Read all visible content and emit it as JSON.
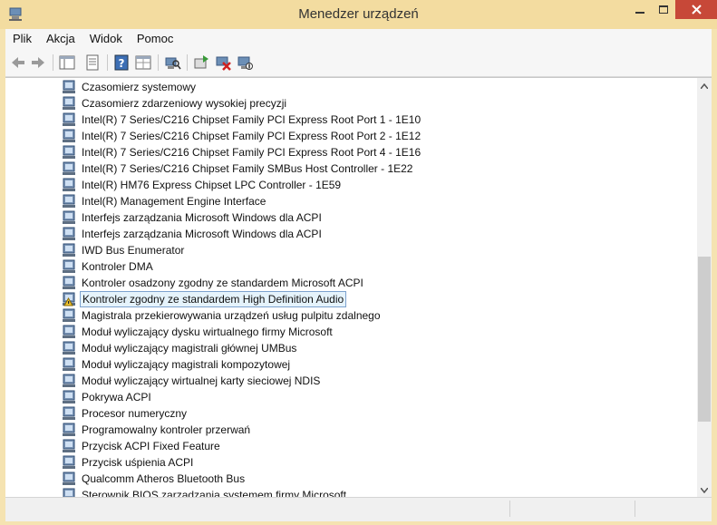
{
  "window": {
    "title": "Menedzer urządzeń",
    "colors": {
      "frame": "#f5e3b1",
      "close": "#c74838",
      "selection_border": "#7da2ce",
      "selection_fill": "#e5f3fb"
    }
  },
  "menu": {
    "items": [
      "Plik",
      "Akcja",
      "Widok",
      "Pomoc"
    ]
  },
  "toolbar": {
    "buttons": [
      "back-icon",
      "forward-icon",
      "console-tree-icon",
      "properties-icon",
      "help-icon",
      "view-icon",
      "scan-hardware-icon",
      "update-driver-icon",
      "uninstall-icon",
      "disable-icon"
    ]
  },
  "devices": [
    "Czasomierz systemowy",
    "Czasomierz zdarzeniowy wysokiej precyzji",
    "Intel(R) 7 Series/C216 Chipset Family PCI Express Root Port 1 - 1E10",
    "Intel(R) 7 Series/C216 Chipset Family PCI Express Root Port 2 - 1E12",
    "Intel(R) 7 Series/C216 Chipset Family PCI Express Root Port 4 - 1E16",
    "Intel(R) 7 Series/C216 Chipset Family SMBus Host Controller - 1E22",
    "Intel(R) HM76 Express Chipset LPC Controller - 1E59",
    "Intel(R) Management Engine Interface",
    "Interfejs zarządzania Microsoft Windows dla ACPI",
    "Interfejs zarządzania Microsoft Windows dla ACPI",
    "IWD Bus Enumerator",
    "Kontroler DMA",
    "Kontroler osadzony zgodny ze standardem Microsoft ACPI",
    "Kontroler zgodny ze standardem High Definition Audio",
    "Magistrala przekierowywania urządzeń usług pulpitu zdalnego",
    "Moduł wyliczający dysku wirtualnego firmy Microsoft",
    "Moduł wyliczający magistrali głównej UMBus",
    "Moduł wyliczający magistrali kompozytowej",
    "Moduł wyliczający wirtualnej karty sieciowej NDIS",
    "Pokrywa ACPI",
    "Procesor numeryczny",
    "Programowalny kontroler przerwań",
    "Przycisk ACPI Fixed Feature",
    "Przycisk uśpienia ACPI",
    "Qualcomm Atheros Bluetooth Bus",
    "Sterownik BIOS zarządzania systemem firmy Microsoft"
  ],
  "selected_index": 13,
  "warning_index": 13
}
